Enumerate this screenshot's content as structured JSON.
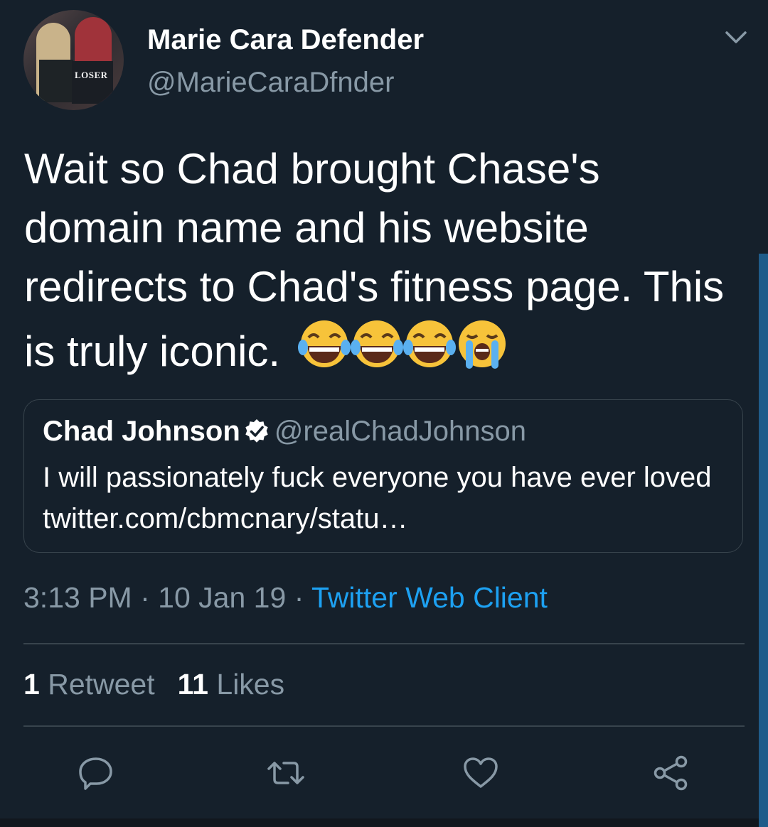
{
  "tweet": {
    "author_name": "Marie Cara Defender",
    "author_handle": "@MarieCaraDfnder",
    "avatar_text": "LOSER",
    "text": "Wait so Chad brought Chase's domain name and his website redirects to Chad's fitness page. This is truly iconic.",
    "emojis": [
      "face-with-tears-of-joy",
      "face-with-tears-of-joy",
      "face-with-tears-of-joy",
      "loudly-crying-face"
    ],
    "time": "3:13 PM",
    "date": "10 Jan 19",
    "separator": "·",
    "client": "Twitter Web Client"
  },
  "quoted": {
    "name": "Chad Johnson",
    "handle": "@realChadJohnson",
    "verified": true,
    "text": "I will passionately fuck everyone you have ever loved twitter.com/cbmcnary/statu…"
  },
  "stats": {
    "retweet_count": "1",
    "retweet_label": "Retweet",
    "like_count": "11",
    "like_label": "Likes"
  },
  "actions": [
    "reply-icon",
    "retweet-icon",
    "like-icon",
    "share-icon"
  ],
  "colors": {
    "background": "#15202b",
    "secondary_text": "#8899a6",
    "link": "#1da1f2",
    "border": "#38444d"
  }
}
